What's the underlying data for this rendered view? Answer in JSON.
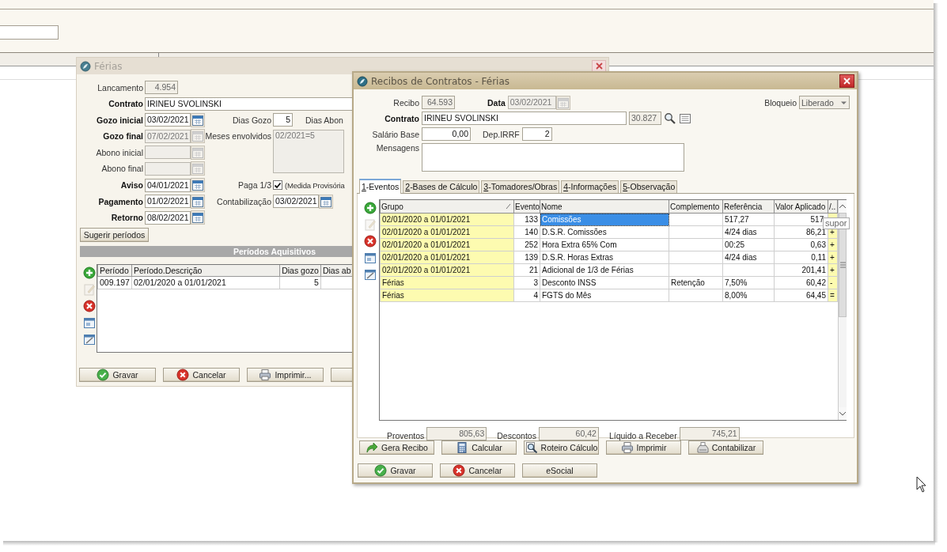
{
  "ferias": {
    "title": "Férias",
    "active": false,
    "lancamento": {
      "label": "Lancamento",
      "value": "4.954",
      "required": false
    },
    "contrato": {
      "label": "Contrato",
      "value": "IRINEU SVOLINSKI",
      "required": true
    },
    "gozo_inicial": {
      "label": "Gozo inicial",
      "value": "03/02/2021",
      "required": true,
      "disabled": false
    },
    "dias_gozo": {
      "label": "Dias Gozo",
      "value": "5"
    },
    "dias_abono": {
      "label": "Dias Abon"
    },
    "gozo_final": {
      "label": "Gozo final",
      "value": "07/02/2021",
      "required": true,
      "disabled": true
    },
    "meses_envolvidos": {
      "label": "Meses envolvidos",
      "value": "02/2021=5"
    },
    "abono_inicial": {
      "label": "Abono inicial",
      "required": false,
      "disabled": true
    },
    "abono_final": {
      "label": "Abono final",
      "required": false,
      "disabled": true
    },
    "aviso": {
      "label": "Aviso",
      "value": "04/01/2021",
      "required": true,
      "disabled": false
    },
    "paga_terco": {
      "label": "Paga 1/3",
      "checked": true,
      "note": "(Medida Provisória"
    },
    "pagamento": {
      "label": "Pagamento",
      "value": "01/02/2021",
      "required": true,
      "disabled": false
    },
    "contabilizacao": {
      "label": "Contabilização",
      "value": "03/02/2021",
      "disabled": false
    },
    "retorno": {
      "label": "Retorno",
      "value": "08/02/2021",
      "required": true,
      "disabled": false
    },
    "suggest_button": "Sugerir períodos",
    "section_title": "Períodos Aquisitivos",
    "toolbar": [
      {
        "kind": "add",
        "disabled": false
      },
      {
        "kind": "edit",
        "disabled": true
      },
      {
        "kind": "delete",
        "disabled": false
      },
      {
        "kind": "form",
        "disabled": false
      },
      {
        "kind": "edit_form",
        "disabled": false
      }
    ],
    "periods": {
      "columns": [
        "Período",
        "Período.Descrição",
        "Dias gozo",
        "Dias ab"
      ],
      "rows": [
        [
          "009.197",
          "02/01/2020 a 01/01/2021",
          "5"
        ]
      ]
    },
    "buttons": [
      {
        "kind": "ok",
        "label": "Gravar"
      },
      {
        "kind": "cancel",
        "label": "Cancelar"
      },
      {
        "kind": "print",
        "label": "Imprimir..."
      },
      {
        "kind": "blank"
      }
    ]
  },
  "recibos": {
    "title": "Recibos de Contratos - Férias",
    "active": true,
    "recibo": {
      "label": "Recibo",
      "value": "64.593"
    },
    "data": {
      "label": "Data",
      "value": "03/02/2021",
      "disabled": true
    },
    "bloqueio": {
      "label": "Bloqueio",
      "value": "Liberado"
    },
    "contrato": {
      "label": "Contrato",
      "value": "IRINEU SVOLINSKI",
      "code": "30.827"
    },
    "salario_base": {
      "label": "Salário Base",
      "value": "0,00"
    },
    "dep_irrf": {
      "label": "Dep.IRRF",
      "value": "2"
    },
    "mensagens": {
      "label": "Mensagens"
    },
    "tabs": [
      {
        "label": "1-Eventos",
        "selected": true
      },
      {
        "label": "2-Bases de Cálculo",
        "selected": false
      },
      {
        "label": "3-Tomadores/Obras",
        "selected": false
      },
      {
        "label": "4-Informações",
        "selected": false
      },
      {
        "label": "5-Observação",
        "selected": false
      }
    ],
    "toolbar": [
      {
        "kind": "add",
        "disabled": false
      },
      {
        "kind": "edit",
        "disabled": true
      },
      {
        "kind": "delete",
        "disabled": false
      },
      {
        "kind": "form",
        "disabled": false
      },
      {
        "kind": "edit_form",
        "disabled": false
      }
    ],
    "events": {
      "columns": [
        "Grupo",
        "Evento",
        "Nome",
        "Complemento",
        "Referência",
        "Valor Aplicado",
        "/.."
      ],
      "rows": [
        {
          "grupo": "02/01/2020 a 01/01/2021",
          "evento": "133",
          "nome": "Comissões",
          "referencia": "517,27",
          "valor": "517,",
          "selected": true
        },
        {
          "grupo": "02/01/2020 a 01/01/2021",
          "evento": "140",
          "nome": "D.S.R. Comissões",
          "referencia": "4/24 dias",
          "valor": "86,21",
          "sinal": "+",
          "selected": false
        },
        {
          "grupo": "02/01/2020 a 01/01/2021",
          "evento": "252",
          "nome": "Hora Extra 65% Com",
          "referencia": "00:25",
          "valor": "0,63",
          "sinal": "+",
          "selected": false
        },
        {
          "grupo": "02/01/2020 a 01/01/2021",
          "evento": "139",
          "nome": "D.S.R. Horas Extras",
          "referencia": "4/24 dias",
          "valor": "0,11",
          "sinal": "+",
          "selected": false
        },
        {
          "grupo": "02/01/2020 a 01/01/2021",
          "evento": "21",
          "nome": "Adicional de 1/3 de Férias",
          "valor": "201,41",
          "sinal": "+",
          "selected": false
        },
        {
          "grupo": "Férias",
          "evento": "3",
          "nome": "Desconto INSS",
          "complemento": "Retenção",
          "referencia": "7,50%",
          "valor": "60,42",
          "sinal": "-",
          "selected": false
        },
        {
          "grupo": "Férias",
          "evento": "4",
          "nome": "FGTS do Mês",
          "referencia": "8,00%",
          "valor": "64,45",
          "sinal": "=",
          "selected": false
        }
      ]
    },
    "tooltip": "supor",
    "totals": [
      {
        "label": "Proventos",
        "value": "805,63"
      },
      {
        "label": "Descontos",
        "value": "60,42"
      },
      {
        "label": "Líquido a Receber",
        "value": "745,21"
      }
    ],
    "actions": [
      {
        "kind": "generate",
        "label": "Gera Recibo"
      },
      {
        "kind": "calculator",
        "label": "Calcular"
      },
      {
        "kind": "inspect",
        "label": "Roteiro Cálculo"
      },
      {
        "kind": "print",
        "label": "Imprimir"
      },
      {
        "kind": "accounting",
        "label": "Contabilizar"
      }
    ],
    "buttons": [
      {
        "kind": "ok",
        "label": "Gravar"
      },
      {
        "kind": "cancel",
        "label": "Cancelar"
      },
      {
        "kind": "plain",
        "label": "eSocial"
      }
    ]
  }
}
